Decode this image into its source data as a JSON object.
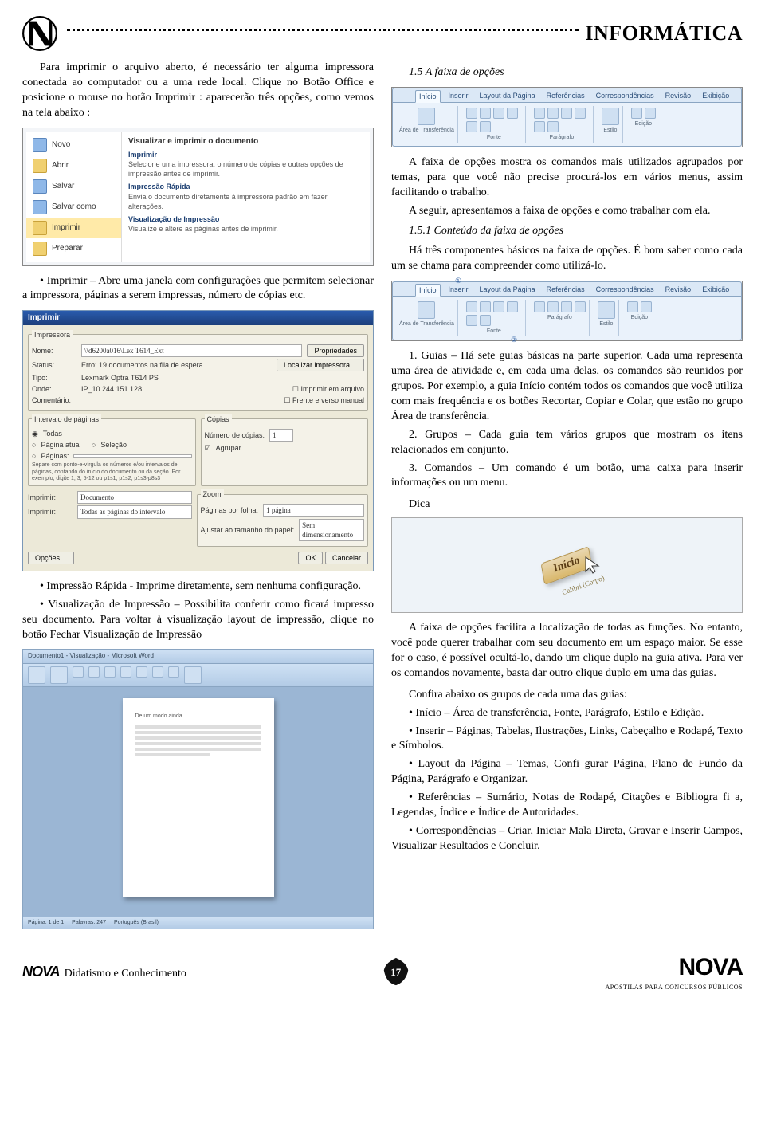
{
  "header": {
    "title": "INFORMÁTICA"
  },
  "left": {
    "p1": "Para imprimir o arquivo aberto, é necessário ter alguma impressora conectada ao computador ou a uma rede local. Clique no Botão Office e posicione o mouse no botão Imprimir : aparecerão três opções, como vemos na tela abaixo :",
    "office": {
      "leftItems": [
        "Novo",
        "Abrir",
        "Salvar",
        "Salvar como",
        "Imprimir",
        "Preparar"
      ],
      "rightTitle": "Visualizar e imprimir o documento",
      "opt1_b": "Imprimir",
      "opt1_t": "Selecione uma impressora, o número de cópias e outras opções de impressão antes de imprimir.",
      "opt2_b": "Impressão Rápida",
      "opt2_t": "Envia o documento diretamente à impressora padrão em fazer alterações.",
      "opt3_b": "Visualização de Impressão",
      "opt3_t": "Visualize e altere as páginas antes de imprimir."
    },
    "p2": "•   Imprimir – Abre uma janela com configurações que permitem selecionar a impressora, páginas a serem impressas, número de cópias etc.",
    "print": {
      "title": "Imprimir",
      "sec_printer": "Impressora",
      "lbl_name": "Nome:",
      "val_name": "\\\\d6200a016\\Lex T614_Ext",
      "btn_props": "Propriedades",
      "lbl_status": "Status:",
      "val_status": "Erro: 19 documentos na fila de espera",
      "btn_find": "Localizar impressora…",
      "lbl_type": "Tipo:",
      "val_type": "Lexmark Optra T614 PS",
      "lbl_where": "Onde:",
      "val_where": "IP_10.244.151.128",
      "lbl_comment": "Comentário:",
      "chk_tofile": "Imprimir em arquivo",
      "chk_duplex": "Frente e verso manual",
      "sec_range": "Intervalo de páginas",
      "r_all": "Todas",
      "r_cur": "Página atual",
      "r_sel": "Seleção",
      "r_pages": "Páginas:",
      "r_hint": "Separe com ponto-e-vírgula os números e/ou intervalos de páginas, contando do início do documento ou da seção. Por exemplo, digite 1, 3, 5-12 ou p1s1, p1s2, p1s3-p8s3",
      "sec_copies": "Cópias",
      "lbl_copies": "Número de cópias:",
      "val_copies": "1",
      "chk_collate": "Agrupar",
      "lbl_printwhat": "Imprimir:",
      "val_printwhat": "Documento",
      "lbl_printsel": "Imprimir:",
      "val_printsel": "Todas as páginas do intervalo",
      "sec_zoom": "Zoom",
      "lbl_ppSheet": "Páginas por folha:",
      "val_ppSheet": "1 página",
      "lbl_scale": "Ajustar ao tamanho do papel:",
      "val_scale": "Sem dimensionamento",
      "btn_options": "Opções…",
      "btn_ok": "OK",
      "btn_cancel": "Cancelar"
    },
    "p3": "•   Impressão Rápida - Imprime diretamente, sem nenhuma configuração.",
    "p4": "•   Visualização de Impressão – Possibilita conferir como ficará impresso seu documento. Para voltar à visualização layout de impressão, clique no botão  Fechar Visualização de Impressão",
    "preview": {
      "title": "Documento1 - Visualização - Microsoft Word",
      "status_left": "Página: 1 de 1",
      "status_words": "Palavras: 247",
      "status_lang": "Português (Brasil)"
    }
  },
  "right": {
    "s15": "1.5 A faixa de opções",
    "ribbonTabs": [
      "Início",
      "Inserir",
      "Layout da Página",
      "Referências",
      "Correspondências",
      "Revisão",
      "Exibição"
    ],
    "ribbonGroups": [
      "Área de Transferência",
      "Fonte",
      "Parágrafo",
      "Estilo",
      "Edição"
    ],
    "p_r1": "A faixa de opções mostra os comandos mais utilizados agrupados por temas, para que você não precise procurá-los em vários menus, assim facilitando o trabalho.",
    "p_r2": "A seguir, apresentamos a faixa de opções e como trabalhar com ela.",
    "s151": "1.5.1 Conteúdo da faixa de opções",
    "p_r3": "Há três componentes básicos na faixa de opções. É bom saber como cada um se chama para compreender como utilizá-lo.",
    "callout1": "1",
    "callout2": "2",
    "p_g1": "1.    Guias – Há sete guias básicas na parte superior. Cada uma representa uma área de atividade e, em cada uma delas, os comandos são reunidos por grupos. Por exemplo, a guia Início contém todos os comandos que você utiliza com mais frequência e os botões Recortar, Copiar e Colar, que estão no grupo Área de transferência.",
    "p_g2": "2.    Grupos – Cada guia tem vários grupos que mostram os itens relacionados em conjunto.",
    "p_g3": "3.    Comandos – Um comando é um botão, uma caixa para inserir informações ou um menu.",
    "dica": "Dica",
    "tip_tab": "Início",
    "tip_sub": "Calibri (Corpo)",
    "p_r4": "A faixa de opções facilita a localização de todas as funções. No entanto, você pode querer trabalhar com seu documento em um espaço maior. Se esse for o caso, é possível ocultá-lo, dando um clique duplo na guia ativa. Para ver os comandos novamente, basta dar outro clique duplo em uma das guias.",
    "p_r5": "Confira abaixo os grupos de cada uma das guias:",
    "b1": "•  Início – Área de transferência, Fonte, Parágrafo, Estilo e Edição.",
    "b2": "•  Inserir – Páginas, Tabelas, Ilustrações, Links, Cabeçalho e Rodapé, Texto e Símbolos.",
    "b3": "•  Layout da Página – Temas, Confi gurar Página, Plano de Fundo da Página, Parágrafo e Organizar.",
    "b4": "•  Referências – Sumário, Notas de Rodapé, Citações e Bibliogra fi a, Legendas, Índice e Índice de Autoridades.",
    "b5": "•  Correspondências – Criar, Iniciar Mala Direta, Gravar e Inserir Campos, Visualizar Resultados e Concluir."
  },
  "footer": {
    "nova": "NOVA",
    "sub": "Didatismo e Conhecimento",
    "page": "17",
    "nova_big": "NOVA",
    "sub2": "APOSTILAS PARA CONCURSOS PÚBLICOS"
  }
}
